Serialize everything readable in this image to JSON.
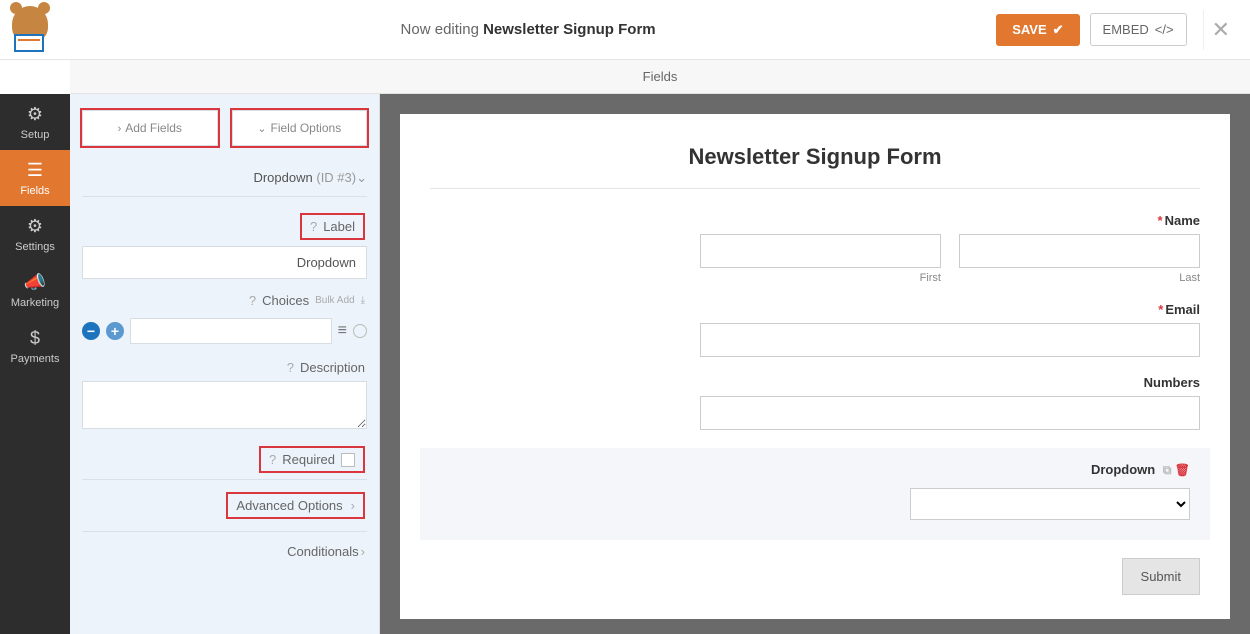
{
  "top": {
    "editing_prefix": "Now editing ",
    "form_name": "Newsletter Signup Form",
    "save": "SAVE",
    "embed": "EMBED"
  },
  "subheader": "Fields",
  "nav": {
    "setup": "Setup",
    "fields": "Fields",
    "settings": "Settings",
    "marketing": "Marketing",
    "payments": "Payments"
  },
  "panel": {
    "tab_add": "Add Fields",
    "tab_options": "Field Options",
    "field_type": "Dropdown",
    "field_id": "(ID #3)",
    "label_label": "Label",
    "label_value": "Dropdown",
    "choices_label": "Choices",
    "bulk_add": "Bulk Add",
    "description_label": "Description",
    "required_label": "Required",
    "advanced": "Advanced Options",
    "conditionals": "Conditionals"
  },
  "preview": {
    "title": "Newsletter Signup Form",
    "name_label": "Name",
    "first": "First",
    "last": "Last",
    "email_label": "Email",
    "numbers_label": "Numbers",
    "dropdown_label": "Dropdown",
    "submit": "Submit"
  }
}
